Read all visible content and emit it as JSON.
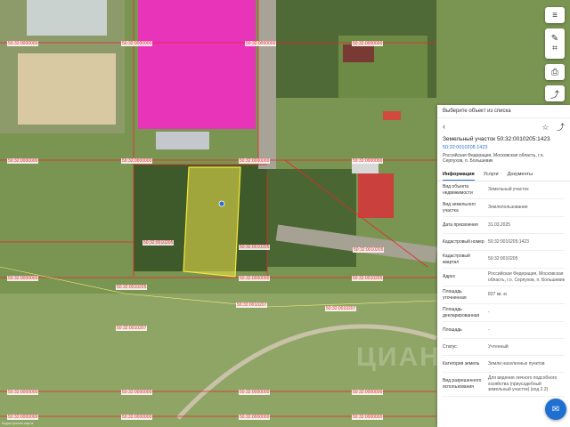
{
  "map": {
    "labels": [
      "50:32:0000000",
      "50:32:0000000",
      "50:32:0000000",
      "50:32:0000000",
      "50:32:0000000",
      "50:32:0000000",
      "50:32:0000000",
      "50:32:0000000",
      "50:32:0010205",
      "50:32:0010205",
      "50:32:0010205",
      "50:32:0000000",
      "50:32:0000000",
      "50:32:0010205",
      "50:32:0010205",
      "50:32:0010207",
      "50:32:0010207",
      "50:32:0010207",
      "50:32:0000000",
      "50:32:0000000",
      "50:32:0000000",
      "50:32:0000000",
      "50:32:0000000",
      "50:32:0000000",
      "50:32:0000000",
      "50:32:0000000"
    ],
    "bottom_text": "Кадастровая карта",
    "watermark": "ЦИАН"
  },
  "panel": {
    "header": "Выберите объект из списка",
    "title": "Земельный участок 50:32:0010205:1423",
    "number_link": "50:32:0010205:1423",
    "address_short": "Российская Федерация, Московская область, г.о. Серпухов, п. Большевик",
    "tabs": [
      "Информация",
      "Услуги",
      "Документы"
    ],
    "rows": [
      {
        "k": "Вид объекта недвижимости",
        "v": "Земельный участок"
      },
      {
        "k": "Вид земельного участка",
        "v": "Землепользование"
      },
      {
        "k": "Дата присвоения",
        "v": "31.03.2025"
      },
      {
        "k": "Кадастровый номер",
        "v": "50:32:0010205:1423"
      },
      {
        "k": "Кадастровый квартал",
        "v": "50:32:0010205"
      },
      {
        "k": "Адрес",
        "v": "Российская Федерация, Московская область, г.о. Серпухов, п. Большевик"
      },
      {
        "k": "Площадь уточненная",
        "v": "837 кв. м"
      },
      {
        "k": "Площадь декларированная",
        "v": "-"
      },
      {
        "k": "Площадь",
        "v": "-"
      },
      {
        "k": "Статус",
        "v": "Учтенный"
      },
      {
        "k": "Категория земель",
        "v": "Земли населенных пунктов"
      },
      {
        "k": "Вид разрешенного использования",
        "v": "Для ведения личного подсобного хозяйства (приусадебный земельный участок) (код 2.2)"
      }
    ]
  },
  "colors": {
    "accent": "#2b6fd1",
    "boundary": "#e8262b",
    "selected": "#f2e64a",
    "highlight": "#ff1fd0"
  },
  "icons": [
    "layers-icon",
    "edit-icon",
    "ruler-icon",
    "print-icon",
    "share-icon",
    "back-icon",
    "star-icon",
    "share-panel-icon",
    "chat-icon"
  ]
}
